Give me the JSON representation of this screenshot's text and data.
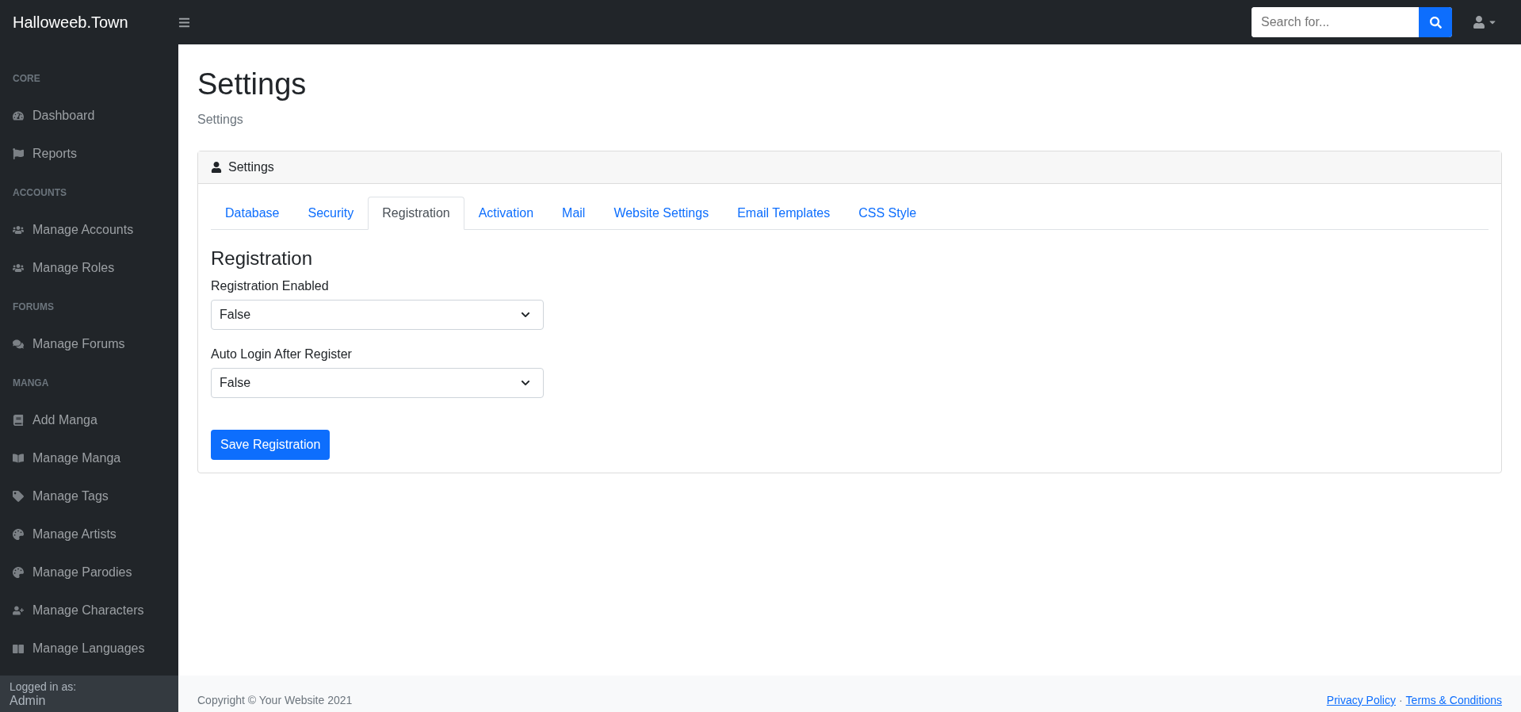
{
  "brand": "Halloweeb.Town",
  "topbar": {
    "search_placeholder": "Search for..."
  },
  "sidebar": {
    "sections": [
      {
        "heading": "CORE",
        "items": [
          {
            "label": "Dashboard"
          },
          {
            "label": "Reports"
          }
        ]
      },
      {
        "heading": "ACCOUNTS",
        "items": [
          {
            "label": "Manage Accounts"
          },
          {
            "label": "Manage Roles"
          }
        ]
      },
      {
        "heading": "FORUMS",
        "items": [
          {
            "label": "Manage Forums"
          }
        ]
      },
      {
        "heading": "MANGA",
        "items": [
          {
            "label": "Add Manga"
          },
          {
            "label": "Manage Manga"
          },
          {
            "label": "Manage Tags"
          },
          {
            "label": "Manage Artists"
          },
          {
            "label": "Manage Parodies"
          },
          {
            "label": "Manage Characters"
          },
          {
            "label": "Manage Languages"
          }
        ]
      }
    ],
    "footer": {
      "caption": "Logged in as:",
      "user": "Admin"
    }
  },
  "page": {
    "title": "Settings",
    "breadcrumb": "Settings"
  },
  "card": {
    "header": "Settings",
    "tabs": [
      {
        "label": "Database",
        "selected": false
      },
      {
        "label": "Security",
        "selected": false
      },
      {
        "label": "Registration",
        "selected": true
      },
      {
        "label": "Activation",
        "selected": false
      },
      {
        "label": "Mail",
        "selected": false
      },
      {
        "label": "Website Settings",
        "selected": false
      },
      {
        "label": "Email Templates",
        "selected": false
      },
      {
        "label": "CSS Style",
        "selected": false
      }
    ],
    "section_title": "Registration",
    "fields": [
      {
        "label": "Registration Enabled",
        "value": "False"
      },
      {
        "label": "Auto Login After Register",
        "value": "False"
      }
    ],
    "button": "Save Registration"
  },
  "footer": {
    "copyright": "Copyright © Your Website 2021",
    "links": [
      "Privacy Policy",
      "Terms & Conditions"
    ],
    "separator": "·"
  }
}
